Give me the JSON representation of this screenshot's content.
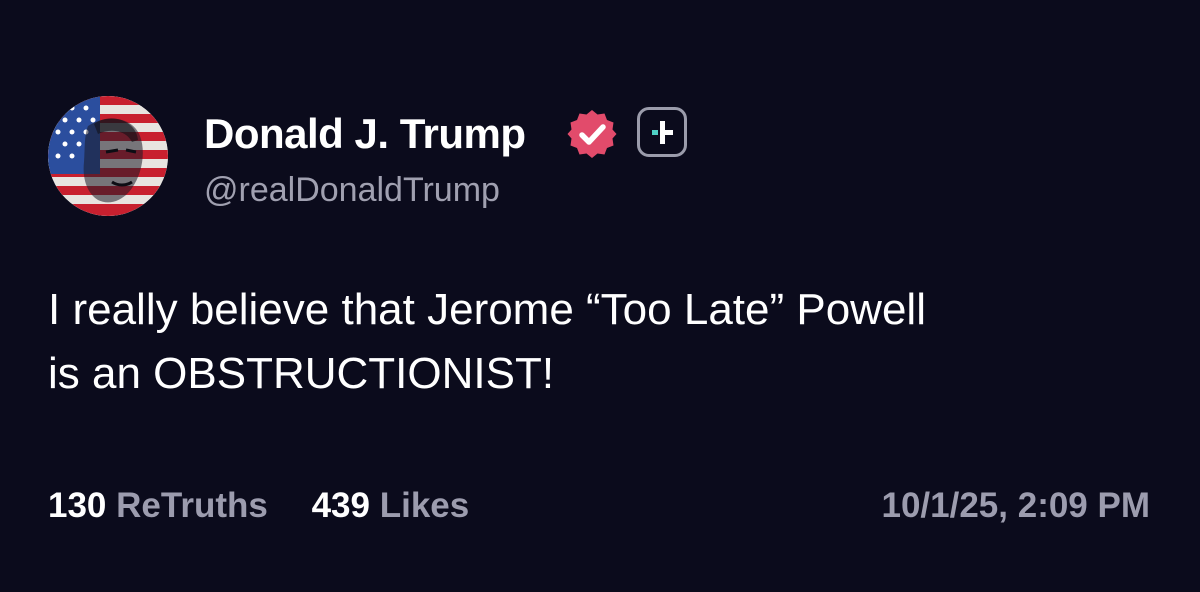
{
  "author": {
    "display_name": "Donald J. Trump",
    "handle": "@realDonaldTrump",
    "avatar_icon": "flag-portrait-avatar",
    "verified_icon": "verified-badge-icon",
    "verified_color": "#e24b6b",
    "plus_icon": "plus-badge-icon"
  },
  "post": {
    "text": "I really believe that Jerome “Too Late” Powell\nis an OBSTRUCTIONIST!"
  },
  "stats": {
    "retruths_count": "130",
    "retruths_label": "ReTruths",
    "likes_count": "439",
    "likes_label": "Likes"
  },
  "timestamp": "10/1/25, 2:09 PM",
  "colors": {
    "background": "#0b0b1c",
    "text_primary": "#ffffff",
    "text_secondary": "#9c9cae"
  }
}
